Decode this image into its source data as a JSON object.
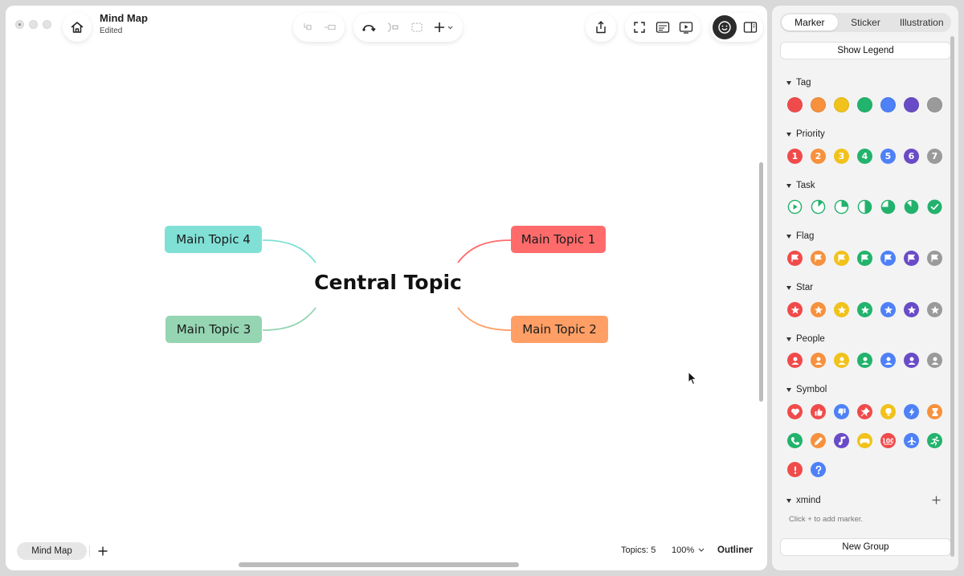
{
  "window": {
    "title": "Mind Map",
    "status": "Edited"
  },
  "icons": {
    "home": "home-icon",
    "fill": "fill-icon",
    "indent": "indent-icon",
    "relationship": "relationship-icon",
    "summary": "summary-icon",
    "boundary": "boundary-icon",
    "insert": "plus-icon",
    "share": "share-icon",
    "fullscreen": "fullscreen-icon",
    "pitch": "pitch-icon",
    "play": "play-icon",
    "emoji": "emoji-icon",
    "sidebar": "sidebar-icon"
  },
  "map": {
    "central": "Central Topic",
    "topics": [
      {
        "label": "Main Topic 1",
        "color": "#ff6b6b"
      },
      {
        "label": "Main Topic 2",
        "color": "#ff9f66"
      },
      {
        "label": "Main Topic 3",
        "color": "#95d5b2"
      },
      {
        "label": "Main Topic 4",
        "color": "#80e0d6"
      }
    ]
  },
  "bottom": {
    "sheet_tab": "Mind Map",
    "topics_count": "Topics: 5",
    "zoom": "100%",
    "outliner": "Outliner"
  },
  "panel": {
    "tabs": [
      "Marker",
      "Sticker",
      "Illustration"
    ],
    "active_tab": "Marker",
    "show_legend": "Show Legend",
    "new_group": "New Group",
    "palette": [
      "#f04b4b",
      "#f7913d",
      "#f1c21b",
      "#22b36c",
      "#4e81f7",
      "#6a4bc7",
      "#9a9a9a"
    ],
    "groups": {
      "tag": "Tag",
      "priority": "Priority",
      "task": "Task",
      "flag": "Flag",
      "star": "Star",
      "people": "People",
      "symbol": "Symbol",
      "xmind": "xmind"
    },
    "priorities": [
      "1",
      "2",
      "3",
      "4",
      "5",
      "6",
      "7"
    ],
    "xmind_hint": "Click + to add marker."
  }
}
